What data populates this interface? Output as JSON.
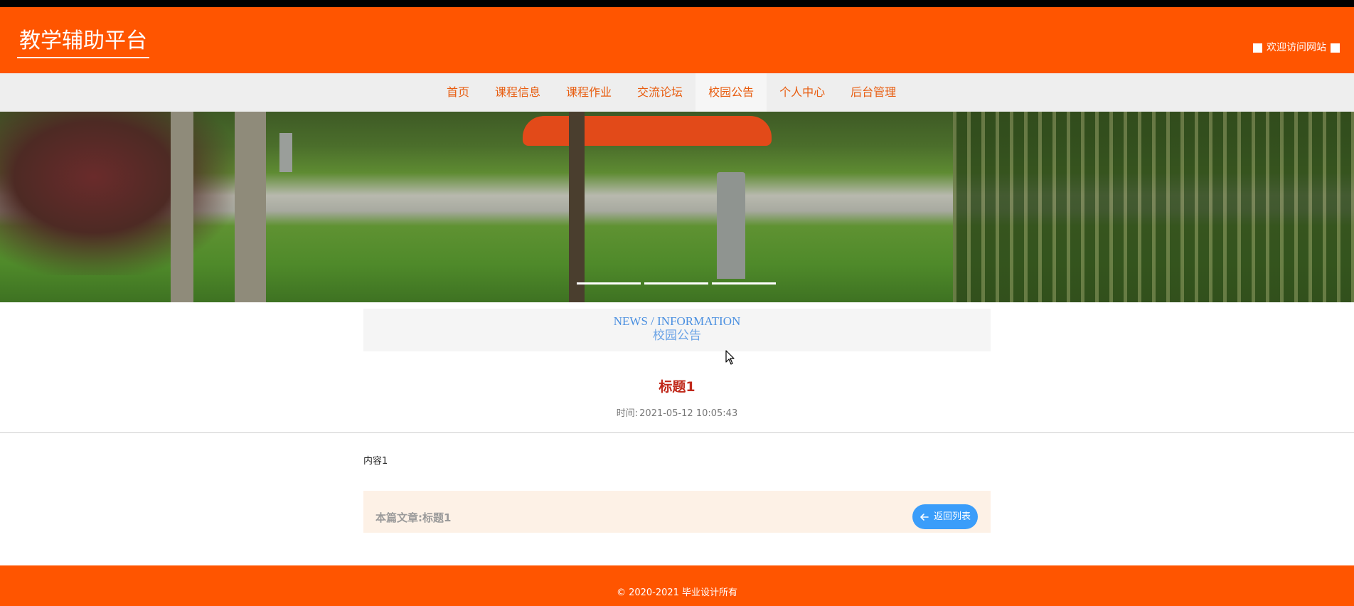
{
  "header": {
    "site_title": "教学辅助平台",
    "welcome_text": "欢迎访问网站"
  },
  "nav": {
    "items": [
      {
        "label": "首页"
      },
      {
        "label": "课程信息"
      },
      {
        "label": "课程作业"
      },
      {
        "label": "交流论坛"
      },
      {
        "label": "校园公告",
        "active": true
      },
      {
        "label": "个人中心"
      },
      {
        "label": "后台管理"
      }
    ]
  },
  "banner": {
    "slide_count": 3
  },
  "section": {
    "title_en": "NEWS / INFORMATION",
    "title_cn": "校园公告"
  },
  "article": {
    "title": "标题1",
    "time_label": "时间:",
    "time_value": "2021-05-12 10:05:43",
    "content": "内容1",
    "this_article_label": "本篇文章:",
    "this_article_title": "标题1",
    "back_button_label": "返回列表"
  },
  "footer": {
    "copyright": "© 2020-2021 毕业设计所有"
  },
  "colors": {
    "brand_orange": "#ff5500",
    "nav_text": "#e85d10",
    "title_red": "#c0281a",
    "link_blue": "#4a8fe0",
    "button_blue": "#3a9dfa"
  }
}
